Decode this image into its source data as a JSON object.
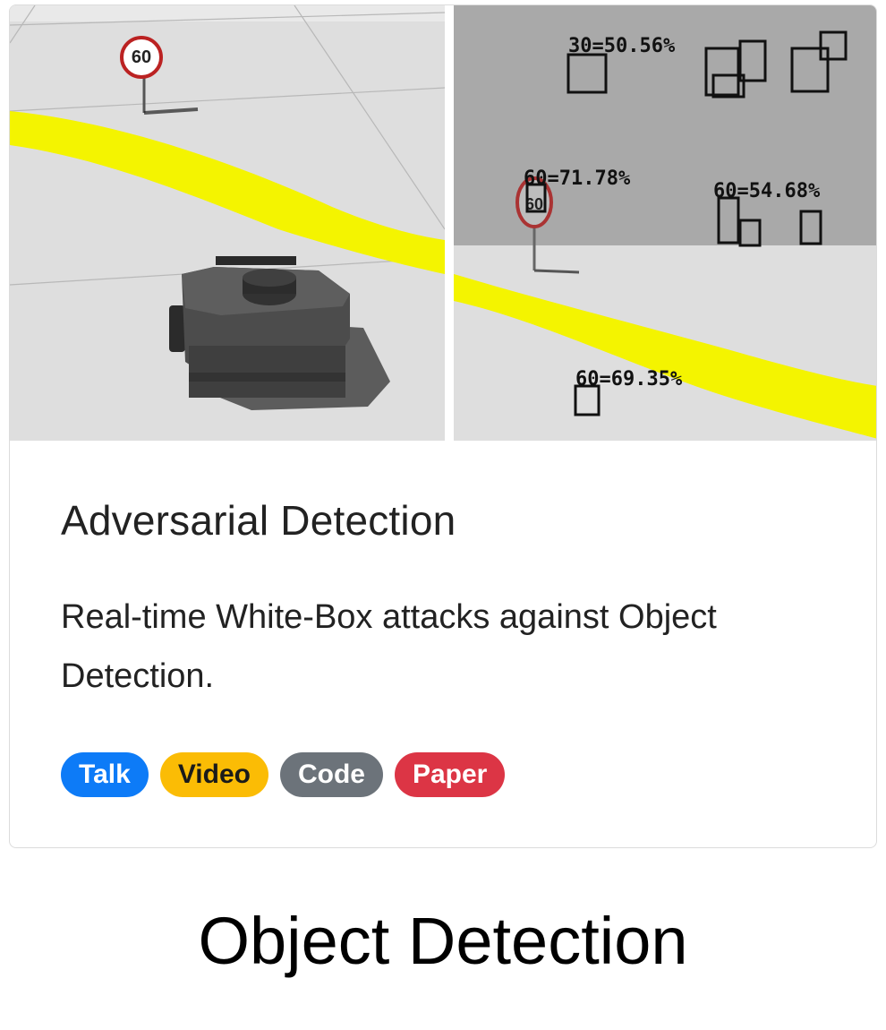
{
  "card": {
    "title": "Adversarial Detection",
    "description": "Real-time White-Box attacks against Object Detection.",
    "badges": [
      {
        "label": "Talk",
        "bg": "#0d7bf7",
        "fg": "#ffffff"
      },
      {
        "label": "Video",
        "bg": "#fbbc05",
        "fg": "#1a1a1a"
      },
      {
        "label": "Code",
        "bg": "#6c737a",
        "fg": "#ffffff"
      },
      {
        "label": "Paper",
        "bg": "#dc3545",
        "fg": "#ffffff"
      }
    ]
  },
  "images": {
    "left": {
      "sign_text": "60"
    },
    "right": {
      "sign_text": "60",
      "detections": [
        "30=50.56%",
        "60=71.78%",
        "60=54.68%",
        "60=69.35%"
      ]
    }
  },
  "caption": "Object Detection",
  "colors": {
    "lane": "#f4f400",
    "floor": "#dedede",
    "sky_gray": "#a9a9a9",
    "robot": "#4a4a4a"
  }
}
